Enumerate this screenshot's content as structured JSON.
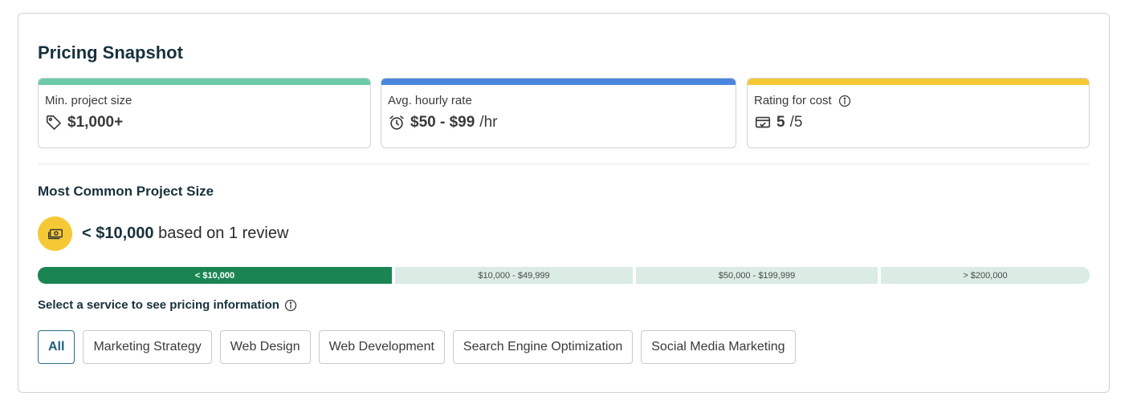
{
  "title": "Pricing Snapshot",
  "stats": [
    {
      "label": "Min. project size",
      "value": "$1,000+",
      "suffix": "",
      "icon": "tag-icon",
      "accent": "#6ccba8"
    },
    {
      "label": "Avg. hourly rate",
      "value": "$50 - $99",
      "suffix": "/hr",
      "icon": "alarm-clock-icon",
      "accent": "#4a86de"
    },
    {
      "label": "Rating for cost",
      "value": "5",
      "suffix": "/5",
      "icon": "card-check-icon",
      "accent": "#f5c936",
      "info_icon": "info-icon"
    }
  ],
  "common_size": {
    "heading": "Most Common Project Size",
    "value": "< $10,000",
    "detail": "based on 1 review",
    "icon": "money-icon"
  },
  "ranges": [
    {
      "label": "< $10,000",
      "active": true
    },
    {
      "label": "$10,000 - $49,999",
      "active": false
    },
    {
      "label": "$50,000 - $199,999",
      "active": false
    },
    {
      "label": "> $200,000",
      "active": false
    }
  ],
  "service_prompt": "Select a service to see pricing information",
  "services": [
    "All",
    "Marketing Strategy",
    "Web Design",
    "Web Development",
    "Search Engine Optimization",
    "Social Media Marketing"
  ],
  "selected_service": "All",
  "colors": {
    "active_range": "#1a8553",
    "inactive_range": "#daece4",
    "selected_chip": "#2a6d86",
    "heading": "#17313b"
  }
}
